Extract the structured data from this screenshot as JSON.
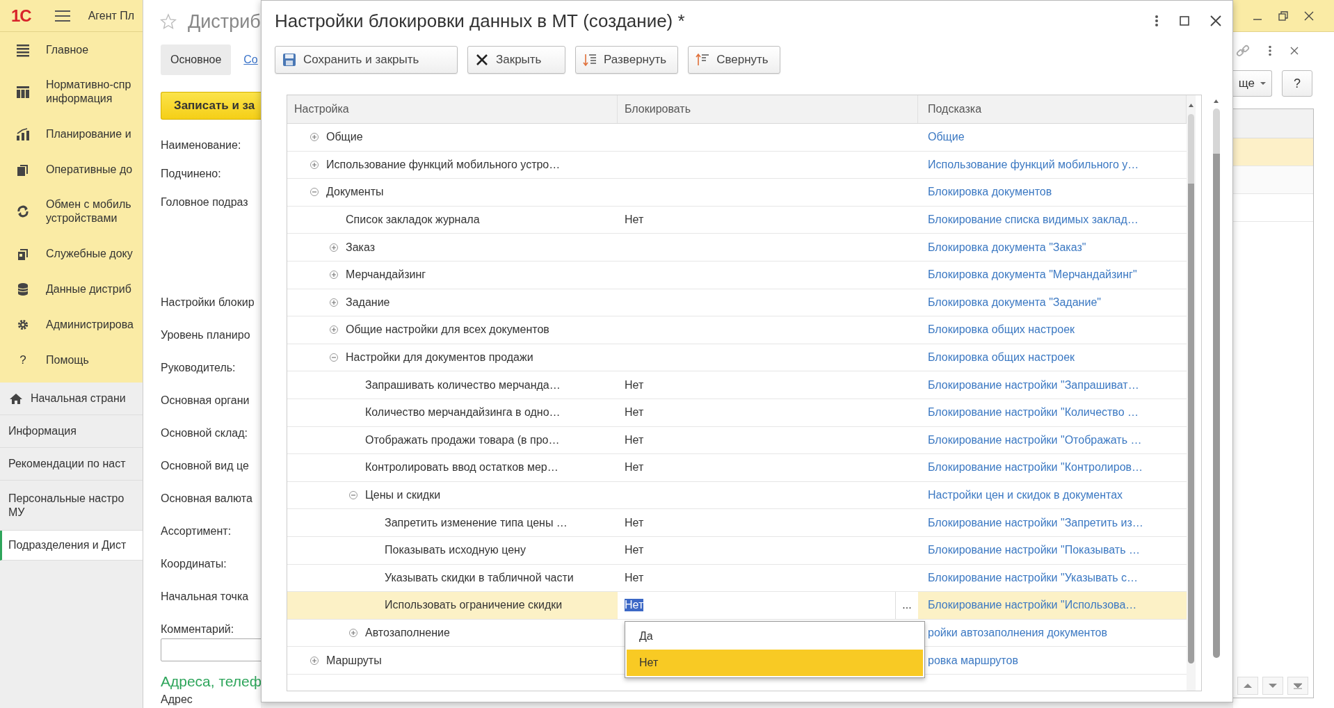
{
  "app_bar": {
    "logo": "1С",
    "title": "Агент Пл"
  },
  "sidebar": {
    "sections": [
      {
        "label": "Главное"
      },
      {
        "label": "Нормативно-спр\nинформация"
      },
      {
        "label": "Планирование и"
      },
      {
        "label": "Оперативные до"
      },
      {
        "label": "Обмен с мобиль\nустройствами"
      },
      {
        "label": "Служебные доку"
      },
      {
        "label": "Данные дистриб"
      },
      {
        "label": "Администрирова"
      },
      {
        "label": "Помощь",
        "icon_text": "?"
      }
    ],
    "nav_items": [
      {
        "label": "Начальная страни",
        "selected": false
      },
      {
        "label": "Информация",
        "selected": false
      },
      {
        "label": "Рекомендации по наст",
        "selected": false
      },
      {
        "label": "Персональные настро\nМУ",
        "selected": false
      },
      {
        "label": "Подразделения и Дист",
        "selected": true
      }
    ]
  },
  "background_form": {
    "title": "Дистриб",
    "tabs": [
      {
        "label": "Основное",
        "selected": true
      },
      {
        "label": "Со",
        "selected": false
      }
    ],
    "save_button": "Записать и за",
    "fields": [
      {
        "label": "Наименование:",
        "kind": "label"
      },
      {
        "label": "Подчинено:",
        "kind": "label"
      },
      {
        "label": "Головное подраз",
        "kind": "label"
      },
      {
        "label": "Настройки блокир",
        "kind": "label"
      },
      {
        "label": "Уровень планиро",
        "kind": "label"
      },
      {
        "label": "Руководитель:",
        "kind": "label"
      },
      {
        "label": "Основная органи",
        "kind": "label"
      },
      {
        "label": "Основной склад:",
        "kind": "label"
      },
      {
        "label": "Основной вид це",
        "kind": "label"
      },
      {
        "label": "Основная валюта",
        "kind": "label"
      },
      {
        "label": "Ассортимент:",
        "kind": "label"
      },
      {
        "label": "Координаты:",
        "kind": "label"
      },
      {
        "label": "Начальная точка",
        "kind": "label"
      },
      {
        "label": "Комментарий:",
        "kind": "input"
      }
    ],
    "section_title": "Адреса, телеф",
    "address_label": "Адрес",
    "more_button": "ще",
    "help_button": "?",
    "list_rows": [
      {
        "selected": true
      },
      {
        "selected": false
      },
      {
        "selected": false
      }
    ]
  },
  "dialog": {
    "title": "Настройки блокировки данных в МТ (создание) *",
    "toolbar": [
      {
        "label": "Сохранить и закрыть"
      },
      {
        "label": "Закрыть"
      },
      {
        "label": "Развернуть"
      },
      {
        "label": "Свернуть"
      }
    ],
    "table": {
      "columns": [
        "Настройка",
        "Блокировать",
        "Подсказка"
      ],
      "choice_button": "...",
      "rows": [
        {
          "name": "Общие",
          "hint": "Общие",
          "expanded": false,
          "selected": false
        },
        {
          "name": "Использование функций мобильного устро…",
          "hint": "Использование функций мобильного у…",
          "expanded": false,
          "selected": false
        },
        {
          "name": "Документы",
          "hint": "Блокировка документов",
          "expanded": true,
          "selected": false,
          "children": [
            {
              "name": "Список закладок журнала",
              "value": "Нет",
              "hint": "Блокирование списка видимых заклад…",
              "selected": false
            },
            {
              "name": "Заказ",
              "hint": "Блокировка документа \"Заказ\"",
              "expanded": false,
              "selected": false
            },
            {
              "name": "Мерчандайзинг",
              "hint": "Блокировка документа \"Мерчандайзинг\"",
              "expanded": false,
              "selected": false
            },
            {
              "name": "Задание",
              "hint": "Блокировка документа \"Задание\"",
              "expanded": false,
              "selected": false
            },
            {
              "name": "Общие настройки для всех документов",
              "hint": "Блокировка общих настроек",
              "expanded": false,
              "selected": false
            },
            {
              "name": "Настройки для документов продажи",
              "hint": "Блокировка общих настроек",
              "expanded": true,
              "selected": false,
              "children": [
                {
                  "name": "Запрашивать количество мерчанда…",
                  "value": "Нет",
                  "hint": "Блокирование настройки \"Запрашиват…",
                  "selected": false
                },
                {
                  "name": "Количество мерчандайзинга в одно…",
                  "value": "Нет",
                  "hint": "Блокирование настройки \"Количество …",
                  "selected": false
                },
                {
                  "name": "Отображать продажи товара (в про…",
                  "value": "Нет",
                  "hint": "Блокирование настройки \"Отображать …",
                  "selected": false
                },
                {
                  "name": "Контролировать ввод остатков мер…",
                  "value": "Нет",
                  "hint": "Блокирование настройки \"Контролиров…",
                  "selected": false
                },
                {
                  "name": "Цены и скидки",
                  "hint": "Настройки цен и скидок в документах",
                  "expanded": true,
                  "selected": false,
                  "children": [
                    {
                      "name": "Запретить изменение типа цены …",
                      "value": "Нет",
                      "hint": "Блокирование настройки \"Запретить из…",
                      "selected": false
                    },
                    {
                      "name": "Показывать исходную цену",
                      "value": "Нет",
                      "hint": "Блокирование настройки \"Показывать …",
                      "selected": false
                    },
                    {
                      "name": "Указывать скидки в табличной части",
                      "value": "Нет",
                      "hint": "Блокирование настройки \"Указывать с…",
                      "selected": false
                    },
                    {
                      "name": "Использовать ограничение скидки",
                      "value": "Нет",
                      "hint": "Блокирование настройки \"Использова…",
                      "selected": true
                    }
                  ]
                },
                {
                  "name": "Автозаполнение",
                  "hint": "ройки автозаполнения документов",
                  "expanded": false,
                  "selected": false
                }
              ]
            }
          ]
        },
        {
          "name": "Маршруты",
          "hint": "ровка маршрутов",
          "expanded": false,
          "selected": false
        }
      ],
      "dropdown": [
        {
          "label": "Да",
          "selected": false
        },
        {
          "label": "Нет",
          "selected": true
        }
      ]
    }
  }
}
